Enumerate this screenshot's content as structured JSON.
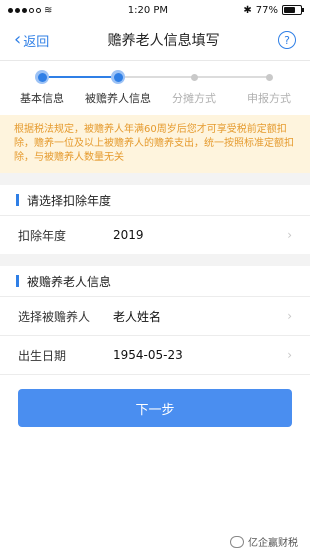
{
  "status_bar": {
    "time": "1:20 PM",
    "battery": "77%",
    "battery_level": 0.77,
    "wifi": "wifi-icon"
  },
  "nav": {
    "back": "返回",
    "title": "赡养老人信息填写",
    "help": "?"
  },
  "steps": [
    {
      "label": "基本信息",
      "state": "done"
    },
    {
      "label": "被赡养人信息",
      "state": "current"
    },
    {
      "label": "分摊方式",
      "state": "todo"
    },
    {
      "label": "申报方式",
      "state": "todo"
    }
  ],
  "notice": "根据税法规定，被赡养人年满60周岁后您才可享受税前定额扣除，赡养一位及以上被赡养人的赡养支出，统一按照标准定额扣除，与被赡养人数量无关",
  "deduction_year": {
    "title": "请选择扣除年度",
    "label": "扣除年度",
    "value": "2019"
  },
  "elder_info": {
    "title": "被赡养老人信息",
    "rows": [
      {
        "label": "选择被赡养人",
        "value": "老人姓名"
      },
      {
        "label": "出生日期",
        "value": "1954-05-23"
      }
    ]
  },
  "next_button": "下一步",
  "watermark": "亿企赢财税",
  "colors": {
    "accent": "#2f7fe6",
    "button": "#4a8ef0",
    "notice_bg": "#fef4dd",
    "notice_text": "#e59a2d"
  }
}
